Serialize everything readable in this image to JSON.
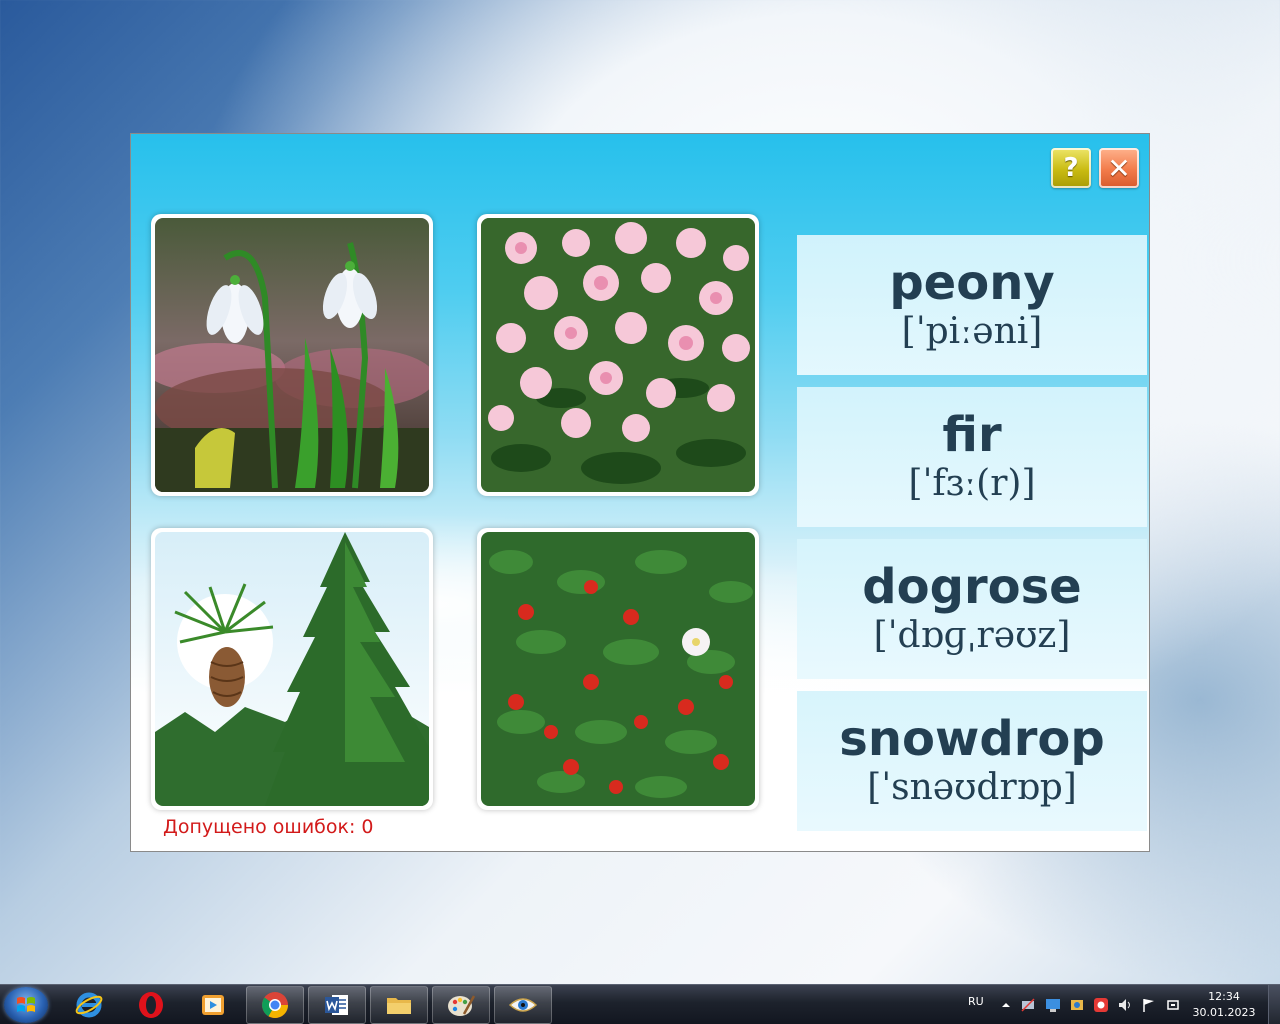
{
  "window": {
    "help_button": "?",
    "close_button": "✕"
  },
  "pictures": [
    {
      "subject": "snowdrop"
    },
    {
      "subject": "peony"
    },
    {
      "subject": "fir"
    },
    {
      "subject": "dogrose"
    }
  ],
  "cards": [
    {
      "word": "peony",
      "transcription": "[ˈpiːəni]"
    },
    {
      "word": "fir",
      "transcription": "[ˈfɜː(r)]"
    },
    {
      "word": "dogrose",
      "transcription": "[ˈdɒɡˌrəʊz]"
    },
    {
      "word": "snowdrop",
      "transcription": "[ˈsnəʊdrɒp]"
    }
  ],
  "status": {
    "errors_text": "Допущено ошибок: 0"
  },
  "taskbar": {
    "apps": [
      "internet-explorer",
      "opera",
      "media-player",
      "chrome",
      "word",
      "file-explorer",
      "paint",
      "eye-app"
    ],
    "language": "RU",
    "time": "12:34",
    "date": "30.01.2023"
  },
  "colors": {
    "card_text": "#233f52",
    "error_text": "#d21a1a",
    "help_button": "#c9bb12",
    "close_button": "#f27b4a"
  }
}
